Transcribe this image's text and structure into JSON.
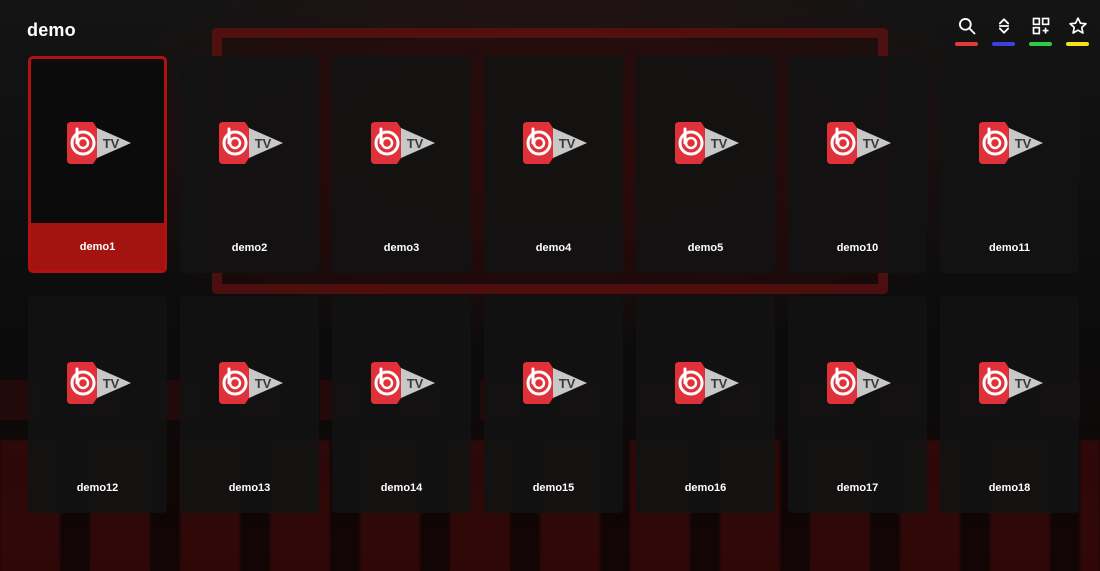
{
  "header": {
    "title": "demo"
  },
  "toolbar": [
    {
      "icon": "search-icon",
      "color": "#e53935"
    },
    {
      "icon": "sort-icon",
      "color": "#3f3fdf"
    },
    {
      "icon": "qr-grid-icon",
      "color": "#2ecc40"
    },
    {
      "icon": "star-icon",
      "color": "#f5e11c"
    }
  ],
  "logo": {
    "text": "TV"
  },
  "channels": [
    {
      "label": "demo1",
      "selected": true
    },
    {
      "label": "demo2"
    },
    {
      "label": "demo3"
    },
    {
      "label": "demo4"
    },
    {
      "label": "demo5"
    },
    {
      "label": "demo10"
    },
    {
      "label": "demo11"
    },
    {
      "label": "demo12"
    },
    {
      "label": "demo13"
    },
    {
      "label": "demo14"
    },
    {
      "label": "demo15"
    },
    {
      "label": "demo16"
    },
    {
      "label": "demo17"
    },
    {
      "label": "demo18"
    }
  ],
  "colors": {
    "accent": "#a3130f",
    "logo_red": "#e0313a",
    "logo_gray": "#c8c8c8"
  }
}
